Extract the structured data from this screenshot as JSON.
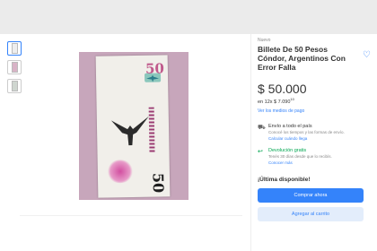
{
  "product": {
    "condition": "Nuevo",
    "title": "Billete De 50 Pesos Cóndor, Argentinos Con Error Falla",
    "price": "$ 50.000",
    "installments_prefix": "en 12x $ 7.090",
    "installments_cents": "10",
    "payment_link": "Ver los medios de pago"
  },
  "shipping": {
    "title": "Envío a todo el país",
    "subtitle": "Conocé los tiempos y las formas de envío.",
    "link": "Calcular cuándo llega"
  },
  "returns": {
    "title": "Devolución gratis",
    "subtitle": "Tenés 30 días desde que lo recibís.",
    "link": "Conocer más"
  },
  "stock_label": "¡Última disponible!",
  "buttons": {
    "buy_now": "Comprar ahora",
    "add_to_cart": "Agregar al carrito"
  },
  "banknote": {
    "denomination_top": "50",
    "denomination_bottom": "50"
  },
  "colors": {
    "accent": "#3483fa",
    "success": "#00a650"
  }
}
